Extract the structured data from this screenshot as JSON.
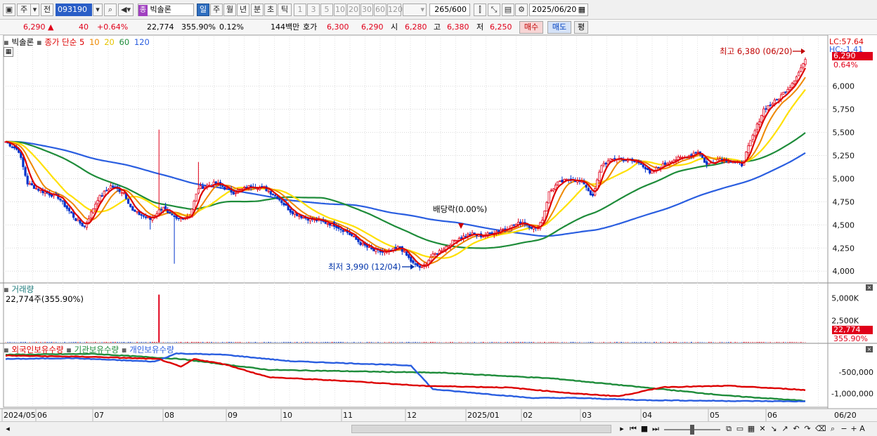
{
  "toolbar": {
    "market_label": "주",
    "prev_label": "전",
    "stock_code": "093190",
    "stock_tag": "종",
    "stock_name": "빅솔론",
    "periods": [
      "일",
      "주",
      "월",
      "년",
      "분",
      "초",
      "틱"
    ],
    "active_period": "일",
    "intervals": [
      "1",
      "3",
      "5",
      "10",
      "20",
      "30",
      "60",
      "120"
    ],
    "bar_count": "265/600",
    "date": "2025/06/20"
  },
  "quote": {
    "price": "6,290",
    "change": "40",
    "change_pct": "+0.64%",
    "volume": "22,774",
    "volume_ratio": "355.90%",
    "turnover": "0.12%",
    "amount": "144백만",
    "hoga_label": "호가",
    "ask": "6,300",
    "bid": "6,290",
    "open_label": "시",
    "open": "6,280",
    "high_label": "고",
    "high": "6,380",
    "low_label": "저",
    "low": "6,250",
    "buy_label": "매수",
    "sell_label": "매도",
    "avg_label": "평"
  },
  "legend": {
    "name": "빅솔론",
    "ma_label": "종가 단순",
    "ma5": "5",
    "ma10": "10",
    "ma20": "20",
    "ma60": "60",
    "ma120": "120",
    "volume_title": "거래량",
    "volume_value": "22,774주(355.90%)",
    "holdings_foreign": "외국인보유수량",
    "holdings_inst": "기관보유수량",
    "holdings_indiv": "개인보유수량"
  },
  "annotations": {
    "lc": "LC:57.64",
    "hc": "HC:-1.41",
    "last_price": "6,290",
    "last_pct": "0.64%",
    "high_note": "최고 6,380 (06/20)",
    "low_note": "최저 3,990 (12/04)",
    "dividend_note": "배당락(0.00%)",
    "last_volume": "22,774",
    "last_volume_pct": "355.90%"
  },
  "colors": {
    "up": "#e0001a",
    "down": "#0033cc",
    "ma5": "#dd0000",
    "ma10": "#ee8800",
    "ma20": "#ffe000",
    "ma60": "#1e8c3a",
    "ma120": "#2a5ee0",
    "foreign": "#dd0000",
    "inst": "#1e8c3a",
    "indiv": "#2a5ee0"
  },
  "chart_data": {
    "type": "line",
    "price_axis": {
      "ticks": [
        4000,
        4250,
        4500,
        4750,
        5000,
        5250,
        5500,
        5750,
        6000
      ],
      "tick_labels": [
        "4,000",
        "4,250",
        "4,500",
        "4,750",
        "5,000",
        "5,250",
        "5,500",
        "5,750",
        "6,000"
      ],
      "range": [
        3880,
        6400
      ]
    },
    "volume_axis": {
      "ticks": [
        2500000,
        5000000
      ],
      "tick_labels": [
        "2,500K",
        "5,000K"
      ],
      "range": [
        0,
        6000000
      ]
    },
    "holdings_axis": {
      "ticks": [
        -500000,
        -1000000
      ],
      "tick_labels": [
        "-500,000",
        "-1,000,000"
      ],
      "range": [
        -1250000,
        50000
      ]
    },
    "x_axis_labels": [
      "2024/05",
      "06",
      "07",
      "08",
      "09",
      "10",
      "11",
      "12",
      "2025/01",
      "02",
      "03",
      "04",
      "05",
      "06"
    ],
    "x_axis_right_label": "06/20",
    "close_anchors": [
      [
        0,
        5400
      ],
      [
        6,
        5300
      ],
      [
        10,
        4950
      ],
      [
        16,
        4870
      ],
      [
        24,
        4800
      ],
      [
        32,
        4560
      ],
      [
        36,
        4480
      ],
      [
        42,
        4780
      ],
      [
        48,
        4920
      ],
      [
        54,
        4850
      ],
      [
        58,
        4650
      ],
      [
        66,
        4560
      ],
      [
        72,
        4700
      ],
      [
        74,
        4620
      ],
      [
        78,
        4560
      ],
      [
        84,
        4600
      ],
      [
        88,
        4900
      ],
      [
        96,
        4950
      ],
      [
        104,
        4850
      ],
      [
        112,
        4920
      ],
      [
        118,
        4900
      ],
      [
        124,
        4800
      ],
      [
        130,
        4650
      ],
      [
        136,
        4580
      ],
      [
        142,
        4550
      ],
      [
        150,
        4500
      ],
      [
        156,
        4420
      ],
      [
        162,
        4300
      ],
      [
        168,
        4220
      ],
      [
        174,
        4200
      ],
      [
        180,
        4260
      ],
      [
        186,
        4080
      ],
      [
        190,
        4030
      ],
      [
        194,
        4150
      ],
      [
        200,
        4250
      ],
      [
        206,
        4350
      ],
      [
        212,
        4400
      ],
      [
        218,
        4380
      ],
      [
        224,
        4430
      ],
      [
        230,
        4480
      ],
      [
        236,
        4530
      ],
      [
        242,
        4450
      ],
      [
        245,
        4560
      ],
      [
        248,
        4850
      ],
      [
        252,
        4950
      ],
      [
        258,
        5000
      ],
      [
        264,
        4950
      ],
      [
        268,
        4800
      ],
      [
        272,
        5150
      ],
      [
        278,
        5220
      ],
      [
        284,
        5200
      ],
      [
        290,
        5170
      ],
      [
        294,
        5050
      ],
      [
        298,
        5120
      ],
      [
        304,
        5200
      ],
      [
        310,
        5230
      ],
      [
        316,
        5300
      ],
      [
        320,
        5150
      ],
      [
        326,
        5220
      ],
      [
        332,
        5180
      ],
      [
        336,
        5150
      ],
      [
        340,
        5400
      ],
      [
        346,
        5750
      ],
      [
        352,
        5850
      ],
      [
        358,
        6000
      ],
      [
        362,
        6150
      ],
      [
        365,
        6290
      ]
    ],
    "volume_spikes": [
      [
        70,
        5400000
      ],
      [
        365,
        22774
      ]
    ],
    "foreign_anchors": [
      [
        0,
        -120000
      ],
      [
        40,
        -150000
      ],
      [
        70,
        -200000
      ],
      [
        80,
        -380000
      ],
      [
        86,
        -200000
      ],
      [
        100,
        -320000
      ],
      [
        120,
        -620000
      ],
      [
        160,
        -720000
      ],
      [
        190,
        -820000
      ],
      [
        230,
        -860000
      ],
      [
        260,
        -1000000
      ],
      [
        280,
        -1060000
      ],
      [
        300,
        -850000
      ],
      [
        330,
        -820000
      ],
      [
        360,
        -900000
      ],
      [
        365,
        -920000
      ]
    ],
    "inst_anchors": [
      [
        0,
        -100000
      ],
      [
        40,
        -80000
      ],
      [
        80,
        -200000
      ],
      [
        120,
        -450000
      ],
      [
        200,
        -520000
      ],
      [
        250,
        -650000
      ],
      [
        300,
        -900000
      ],
      [
        330,
        -1050000
      ],
      [
        360,
        -1150000
      ],
      [
        365,
        -1170000
      ]
    ],
    "indiv_anchors": [
      [
        0,
        -200000
      ],
      [
        30,
        -180000
      ],
      [
        68,
        -260000
      ],
      [
        78,
        -70000
      ],
      [
        100,
        -100000
      ],
      [
        130,
        -250000
      ],
      [
        185,
        -350000
      ],
      [
        195,
        -900000
      ],
      [
        240,
        -1100000
      ],
      [
        260,
        -1100000
      ],
      [
        290,
        -1150000
      ],
      [
        330,
        -1170000
      ],
      [
        365,
        -1180000
      ]
    ]
  }
}
